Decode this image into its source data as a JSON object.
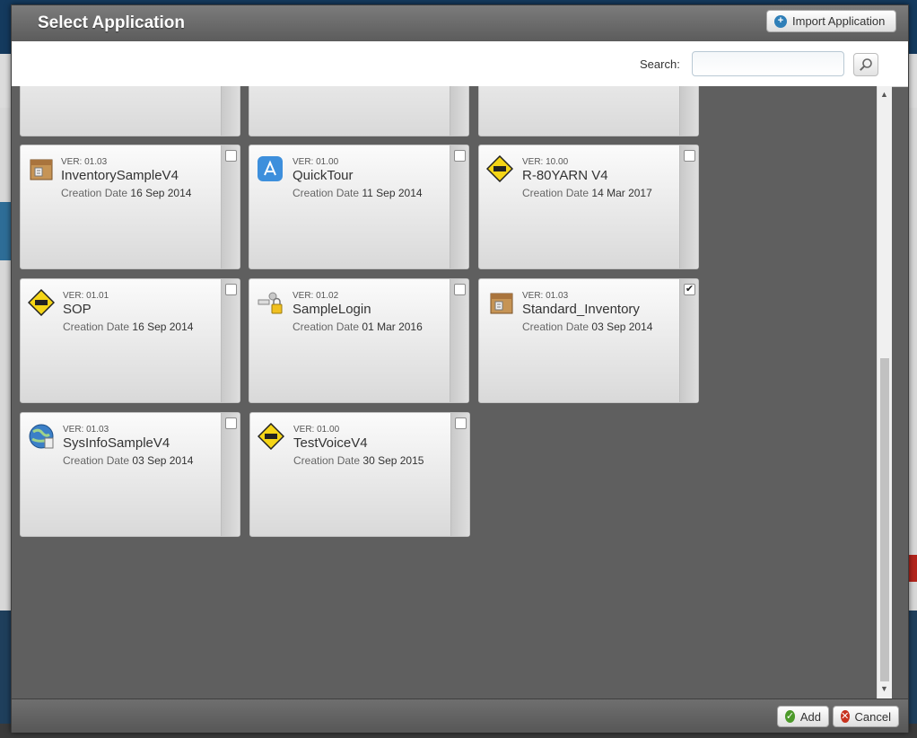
{
  "dialog": {
    "title": "Select Application",
    "import_label": "Import Application",
    "search_label": "Search:",
    "search_value": "",
    "add_label": "Add",
    "cancel_label": "Cancel"
  },
  "apps": [
    {
      "ver": "VER: 01.03",
      "name": "InventorySampleV4",
      "date_label": "Creation Date",
      "date": "16 Sep 2014",
      "icon": "inventory-boxes-icon",
      "checked": false
    },
    {
      "ver": "VER: 01.00",
      "name": "QuickTour",
      "date_label": "Creation Date",
      "date": "11 Sep 2014",
      "icon": "app-store-icon",
      "checked": false
    },
    {
      "ver": "VER: 10.00",
      "name": "R-80YARN V4",
      "date_label": "Creation Date",
      "date": "14 Mar 2017",
      "icon": "under-construction-icon",
      "checked": false
    },
    {
      "ver": "VER: 01.01",
      "name": "SOP",
      "date_label": "Creation Date",
      "date": "16 Sep 2014",
      "icon": "under-construction-icon",
      "checked": false
    },
    {
      "ver": "VER: 01.02",
      "name": "SampleLogin",
      "date_label": "Creation Date",
      "date": "01 Mar 2016",
      "icon": "login-lock-icon",
      "checked": false
    },
    {
      "ver": "VER: 01.03",
      "name": "Standard_Inventory",
      "date_label": "Creation Date",
      "date": "03 Sep 2014",
      "icon": "inventory-boxes-icon",
      "checked": true
    },
    {
      "ver": "VER: 01.03",
      "name": "SysInfoSampleV4",
      "date_label": "Creation Date",
      "date": "03 Sep 2014",
      "icon": "globe-info-icon",
      "checked": false
    },
    {
      "ver": "VER: 01.00",
      "name": "TestVoiceV4",
      "date_label": "Creation Date",
      "date": "30 Sep 2015",
      "icon": "under-construction-icon",
      "checked": false
    }
  ],
  "colors": {
    "accent": "#2f7fb8",
    "add": "#4c9a2a",
    "cancel": "#c8321e"
  }
}
